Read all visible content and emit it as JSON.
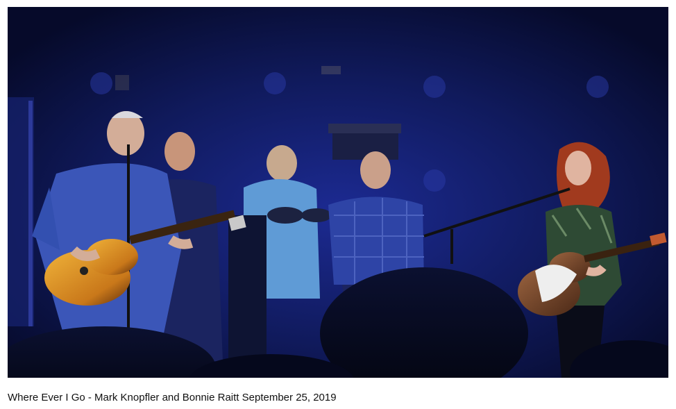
{
  "video": {
    "image_label": "concert-photo",
    "caption": "Where Ever I Go - Mark Knopfler and Bonnie Raitt September 25, 2019"
  },
  "colors": {
    "stage_background": "#0a0f3a",
    "stage_light": "#1e2a8a",
    "guitar_sunburst": "#d9911f",
    "guitar_brown": "#7a4a2c",
    "shirt_blue": "#2d3f9c",
    "hair_red": "#a13a1e"
  }
}
